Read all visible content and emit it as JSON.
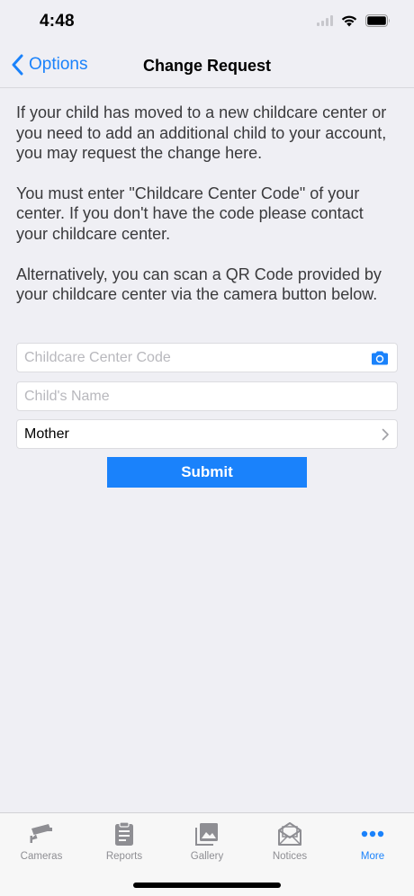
{
  "status_bar": {
    "time": "4:48"
  },
  "nav": {
    "back_label": "Options",
    "title": "Change Request"
  },
  "content": {
    "paragraphs": [
      "If your child has moved to a new childcare center or you need to add an additional child to your account, you may request the change here.",
      "You must enter \"Childcare Center Code\" of your center.  If you don't have the code please contact your childcare center.",
      "Alternatively, you can scan a QR Code provided by your childcare center via the camera button below."
    ]
  },
  "form": {
    "center_code_placeholder": "Childcare Center Code",
    "center_code_value": "",
    "child_name_placeholder": "Child's Name",
    "child_name_value": "",
    "relationship_value": "Mother",
    "submit_label": "Submit"
  },
  "tabs": [
    {
      "label": "Cameras",
      "icon": "camera-cctv-icon"
    },
    {
      "label": "Reports",
      "icon": "clipboard-icon"
    },
    {
      "label": "Gallery",
      "icon": "photos-icon"
    },
    {
      "label": "Notices",
      "icon": "envelope-icon"
    },
    {
      "label": "More",
      "icon": "more-dots-icon",
      "active": true
    }
  ],
  "colors": {
    "accent": "#1a82fb",
    "background": "#efeff4",
    "tab_inactive": "#8e8e93"
  }
}
